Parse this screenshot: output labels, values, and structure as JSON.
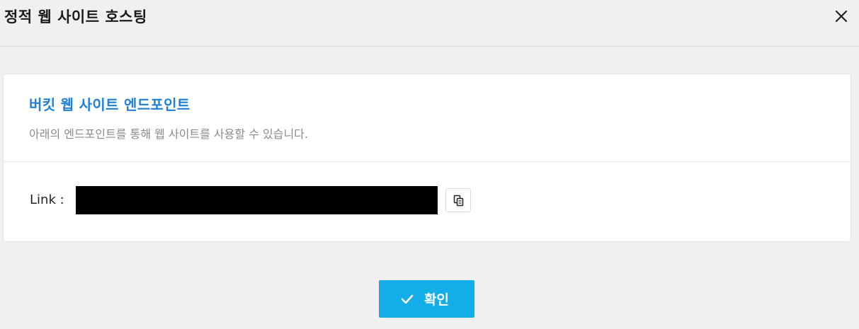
{
  "dialog": {
    "title": "정적 웹 사이트 호스팅",
    "close_icon": "close-icon"
  },
  "endpoint_card": {
    "title": "버킷 웹 사이트 엔드포인트",
    "description": "아래의 엔드포인트를 통해 웹 사이트를 사용할 수 있습니다.",
    "link_label": "Link :",
    "link_value": "",
    "copy_icon": "copy-icon"
  },
  "footer": {
    "confirm_label": "확인",
    "confirm_icon": "check-icon"
  },
  "colors": {
    "accent_title": "#1f7fd6",
    "confirm_button": "#13aee8",
    "link_redaction": "#000000",
    "background": "#f0f0f0"
  }
}
